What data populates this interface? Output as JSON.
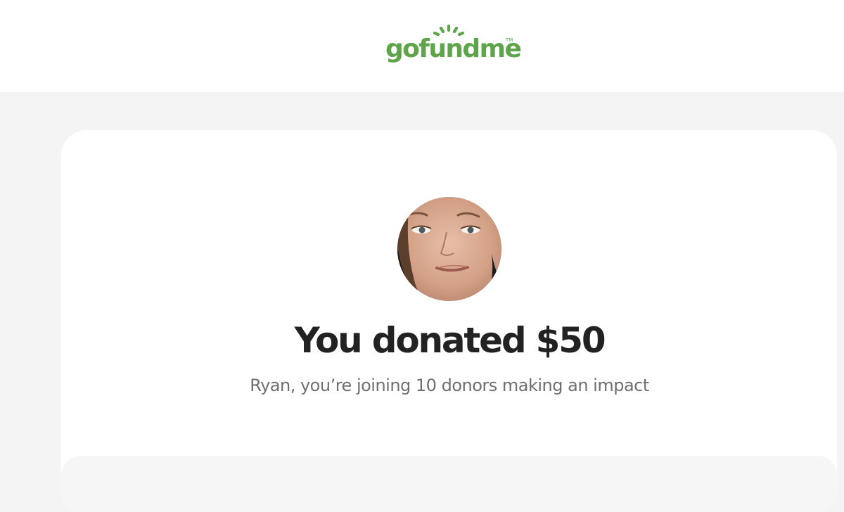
{
  "header": {
    "logo_text": "gofundme",
    "logo_tm": "TM",
    "brand_color": "#5da44b"
  },
  "confirmation": {
    "avatar_alt": "Fundraiser organizer photo",
    "headline": "You donated $50",
    "subline": "Ryan, you’re joining 10 donors making an impact"
  }
}
